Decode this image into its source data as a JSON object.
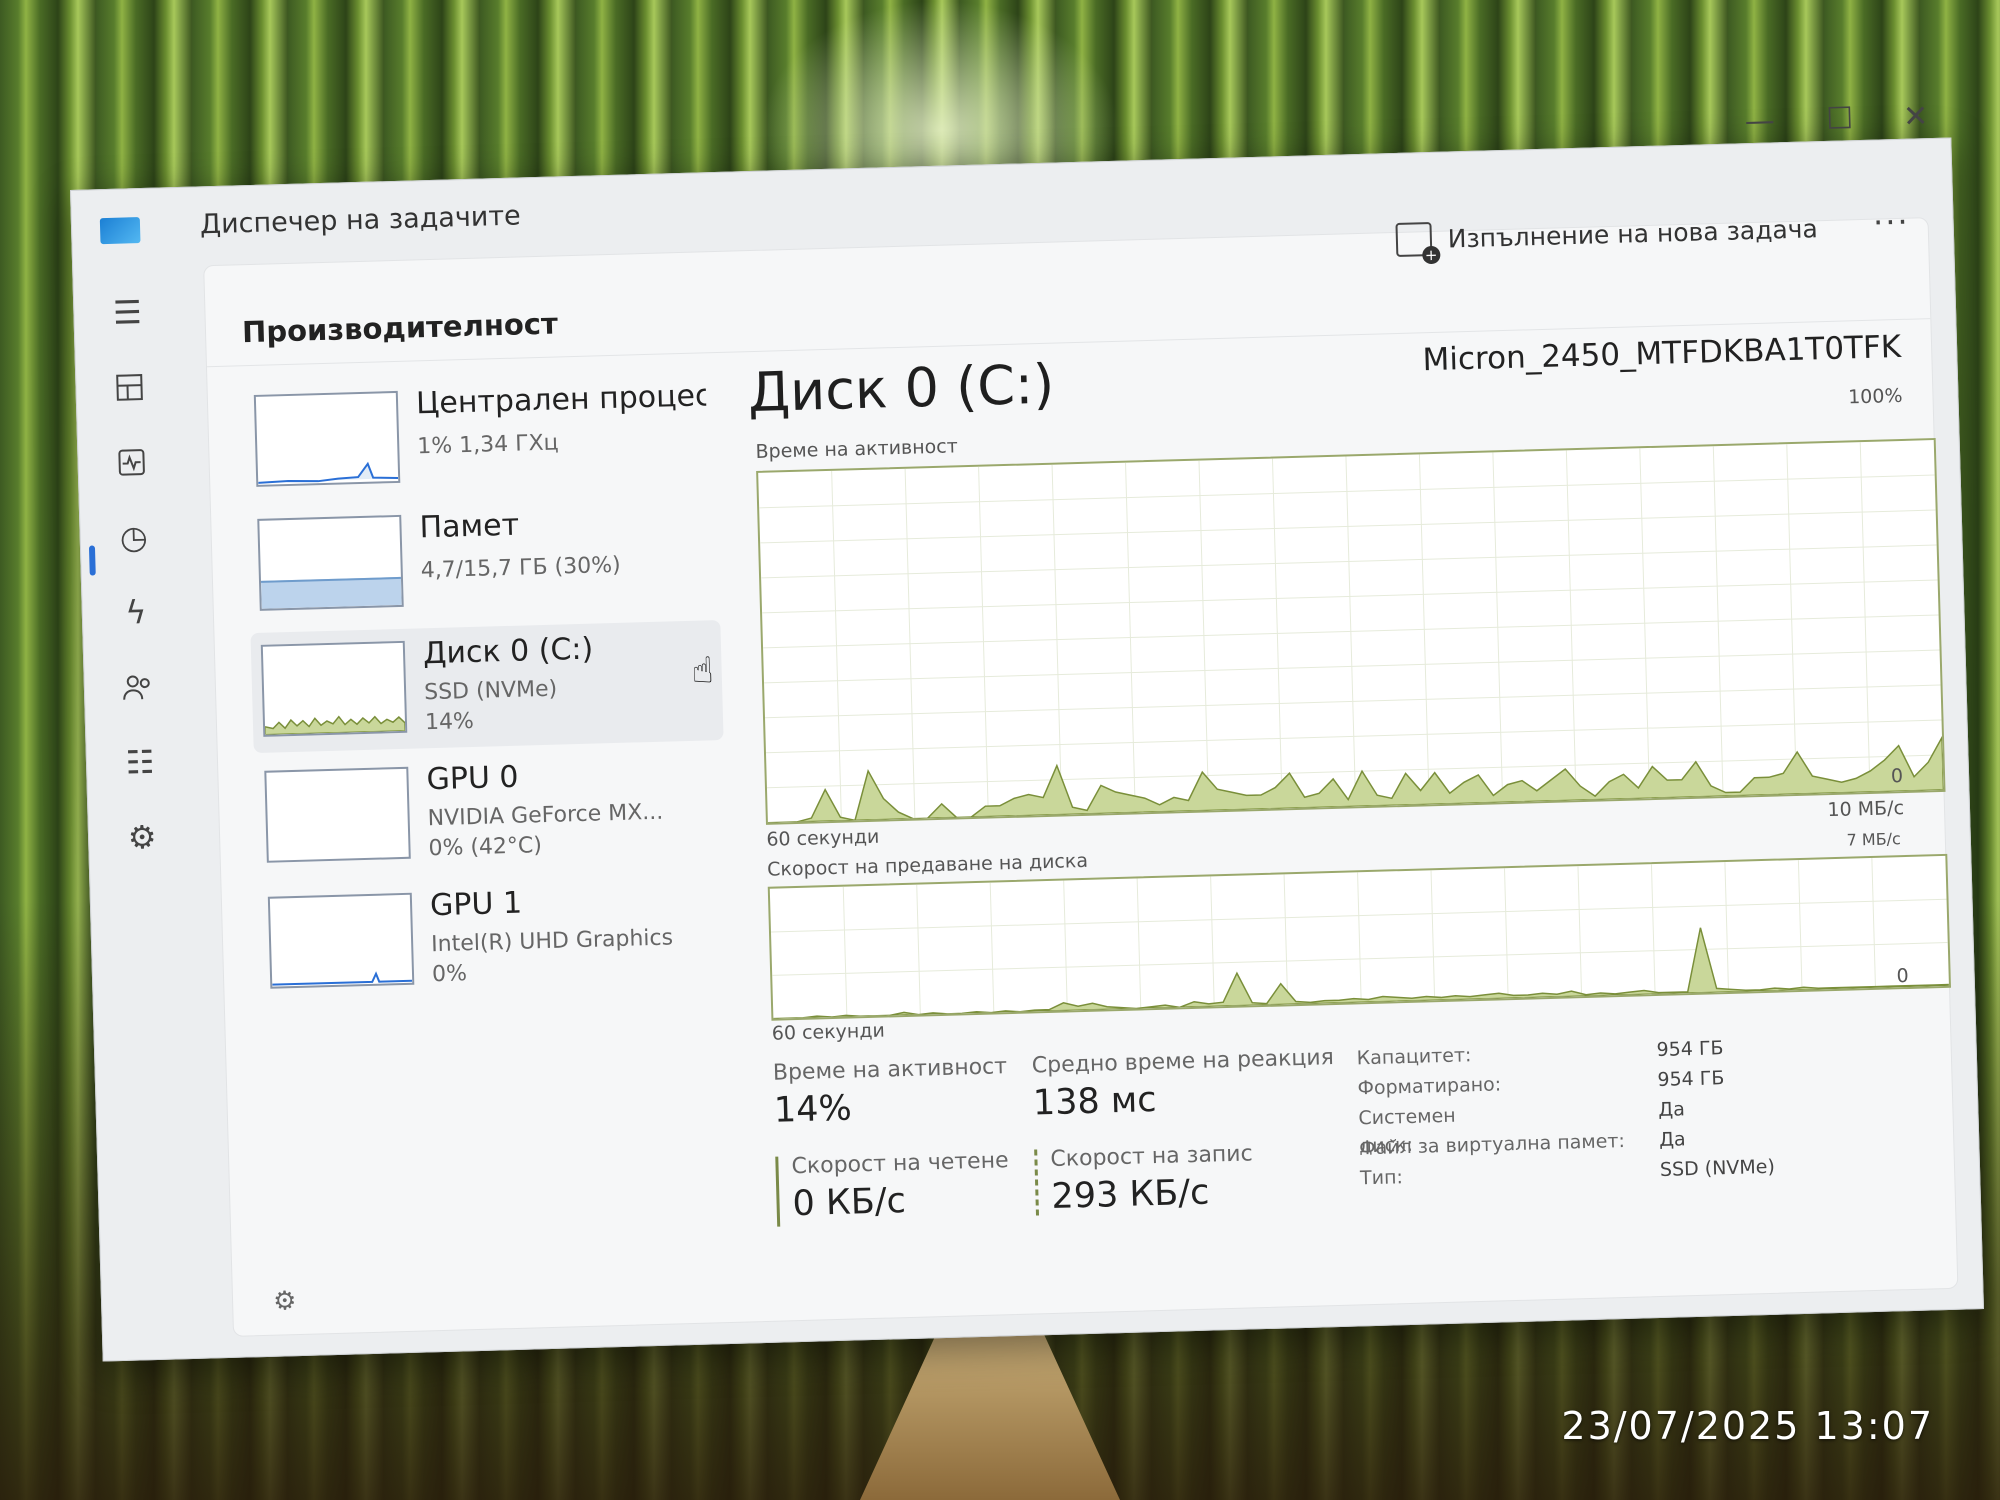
{
  "window": {
    "title": "Диспечер на задачите",
    "controls": {
      "minimize": "—",
      "maximize": "☐",
      "close": "✕"
    }
  },
  "header": {
    "page_title": "Производителност",
    "run_new_task": "Изпълнение на нова задача",
    "more": "···"
  },
  "nav_icons": [
    "menu-icon",
    "processes-icon",
    "performance-icon",
    "app-history-icon",
    "startup-apps-icon",
    "users-icon",
    "details-icon",
    "services-icon"
  ],
  "devices": [
    {
      "name": "Централен процесор",
      "line1": "1%  1,34 ГХц",
      "line2": ""
    },
    {
      "name": "Памет",
      "line1": "4,7/15,7 ГБ (30%)",
      "line2": ""
    },
    {
      "name": "Диск 0 (C:)",
      "line1": "SSD (NVMe)",
      "line2": "14%"
    },
    {
      "name": "GPU 0",
      "line1": "NVIDIA GeForce MX...",
      "line2": "0% (42°C)"
    },
    {
      "name": "GPU 1",
      "line1": "Intel(R) UHD Graphics",
      "line2": "0%"
    }
  ],
  "detail": {
    "title": "Диск 0 (C:)",
    "model": "Micron_2450_MTFDKBA1T0TFK",
    "graph1": {
      "label": "Време на активност",
      "max": "100%",
      "min": "0",
      "time": "60 секунди"
    },
    "graph2": {
      "label": "Скорост на предаване на диска",
      "max": "10 МБ/с",
      "mid": "7 МБ/с",
      "min": "0",
      "time": "60 секунди"
    }
  },
  "stats": {
    "active_time_label": "Време на активност",
    "active_time_value": "14%",
    "response_label": "Средно време на реакция",
    "response_value": "138 мс",
    "read_label": "Скорост на четене",
    "read_value": "0 КБ/с",
    "write_label": "Скорост на запис",
    "write_value": "293 КБ/с"
  },
  "properties": {
    "labels": [
      "Капацитет:",
      "Форматирано:",
      "Системен диск:",
      "Файл за виртуална памет:",
      "Тип:"
    ],
    "values": [
      "954 ГБ",
      "954 ГБ",
      "Да",
      "Да",
      "SSD (NVMe)"
    ]
  },
  "timestamp": "23/07/2025  13:07",
  "colors": {
    "disk_fill": "#c9d79a",
    "disk_line": "#7a8f3a",
    "memory_fill": "#bcd3ec",
    "accent": "#2a6fd6"
  },
  "chart_data": [
    {
      "type": "area",
      "title": "Време на активност",
      "xlabel": "60 секунди",
      "ylim": [
        0,
        100
      ],
      "values": [
        0,
        0,
        0,
        1,
        9,
        1,
        0,
        14,
        6,
        2,
        0,
        0,
        4,
        0,
        0,
        3,
        3,
        5,
        6,
        5,
        14,
        2,
        1,
        8,
        6,
        5,
        4,
        2,
        4,
        3,
        11,
        6,
        5,
        4,
        4,
        6,
        10,
        3,
        4,
        8,
        2,
        10,
        3,
        2,
        9,
        4,
        9,
        3,
        6,
        8,
        2,
        5,
        6,
        3,
        6,
        9,
        4,
        1,
        5,
        7,
        3,
        9,
        5,
        5,
        10,
        3,
        1,
        1,
        5,
        5,
        6,
        12,
        5,
        4,
        3,
        4,
        6,
        9,
        13,
        4,
        8,
        15
      ]
    },
    {
      "type": "area",
      "title": "Скорост на предаване на диска",
      "xlabel": "60 секунди",
      "ylim": [
        0,
        10
      ],
      "values": [
        0,
        0,
        0,
        0.1,
        0,
        0.1,
        0,
        0,
        0,
        0.2,
        0,
        0.1,
        0,
        0,
        0.1,
        0,
        0.1,
        0,
        0.1,
        0.1,
        0.6,
        0.3,
        0.5,
        0.2,
        0.1,
        0,
        0.1,
        0.2,
        0,
        0.4,
        0.2,
        0.3,
        2.5,
        0.2,
        0.1,
        1.6,
        0.2,
        0.1,
        0.2,
        0.2,
        0.3,
        0.2,
        0.4,
        0.3,
        0.2,
        0.3,
        0.2,
        0.3,
        0.2,
        0.3,
        0.4,
        0.2,
        0.2,
        0.3,
        0.2,
        0.4,
        0.1,
        0.2,
        0.1,
        0.2,
        0.3,
        0.1,
        0.1,
        0.1,
        5.0,
        0.3,
        0.2,
        0.1,
        0.1,
        0.2,
        0.1,
        0.2,
        0.1,
        0.1,
        0.1,
        0.1,
        0.1,
        0.1,
        0.1,
        0.1,
        0.1,
        0.1
      ]
    }
  ]
}
